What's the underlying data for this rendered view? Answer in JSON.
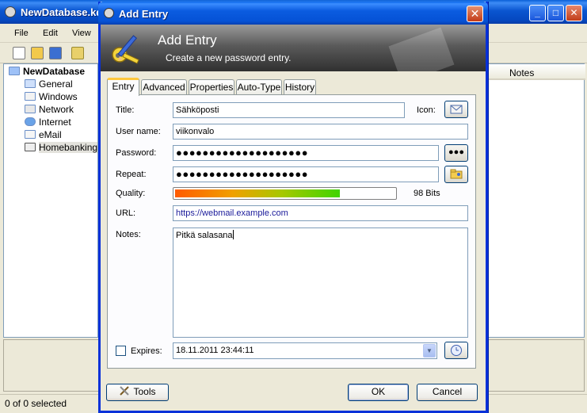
{
  "main": {
    "title": "NewDatabase.kdbx",
    "menu": [
      "File",
      "Edit",
      "View"
    ],
    "tree": [
      {
        "label": "NewDatabase",
        "root": true
      },
      {
        "label": "General"
      },
      {
        "label": "Windows"
      },
      {
        "label": "Network"
      },
      {
        "label": "Internet"
      },
      {
        "label": "eMail"
      },
      {
        "label": "Homebanking",
        "selected": true
      }
    ],
    "columns": {
      "notes": "Notes"
    },
    "status": "0 of 0 selected"
  },
  "dialog": {
    "title": "Add Entry",
    "close": "✕",
    "banner": {
      "title": "Add Entry",
      "subtitle": "Create a new password entry."
    },
    "tabs": [
      "Entry",
      "Advanced",
      "Properties",
      "Auto-Type",
      "History"
    ],
    "active_tab": "Entry",
    "form": {
      "title_label": "Title:",
      "title_value": "Sähköposti",
      "icon_label": "Icon:",
      "username_label": "User name:",
      "username_value": "viikonvalo",
      "password_label": "Password:",
      "password_value": "●●●●●●●●●●●●●●●●●●●●",
      "show_password": "●●●",
      "repeat_label": "Repeat:",
      "repeat_value": "●●●●●●●●●●●●●●●●●●●●",
      "quality_label": "Quality:",
      "quality_fraction": 0.75,
      "quality_bits": "98 Bits",
      "url_label": "URL:",
      "url_value": "https://webmail.example.com",
      "notes_label": "Notes:",
      "notes_value": "Pitkä salasana",
      "expires_label": "Expires:",
      "expires_checked": false,
      "expires_value": "18.11.2011 23:44:11"
    },
    "buttons": {
      "tools": "Tools",
      "ok": "OK",
      "cancel": "Cancel"
    }
  }
}
